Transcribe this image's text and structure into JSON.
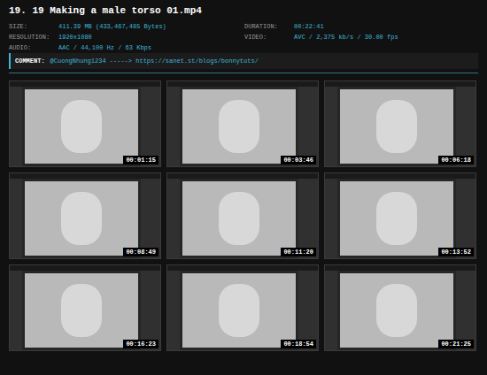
{
  "title": "19. 19 Making a male torso 01.mp4",
  "info": [
    {
      "label": "SIZE:",
      "value": "411.39 MB (433,467,485 Bytes)"
    },
    {
      "label": "DURATION:",
      "value": "00:22:41"
    },
    {
      "label": "RESOLUTION:",
      "value": "1920x1080"
    },
    {
      "label": "VIDEO:",
      "value": "AVC / 2,375 kb/s / 30.00 fps"
    },
    {
      "label": "AUDIO:",
      "value": "AAC / 44,100 Hz / 63 Kbps"
    }
  ],
  "comment": {
    "label": "COMMENT:",
    "text": "@CuongNhung1234 -----> https://sanet.st/blogs/bonnytuts/"
  },
  "thumbnails": [
    {
      "time": "00:01:15"
    },
    {
      "time": "00:03:46"
    },
    {
      "time": "00:06:18"
    },
    {
      "time": "00:08:49"
    },
    {
      "time": "00:11:20"
    },
    {
      "time": "00:13:52"
    },
    {
      "time": "00:16:23"
    },
    {
      "time": "00:18:54"
    },
    {
      "time": "00:21:25"
    }
  ]
}
